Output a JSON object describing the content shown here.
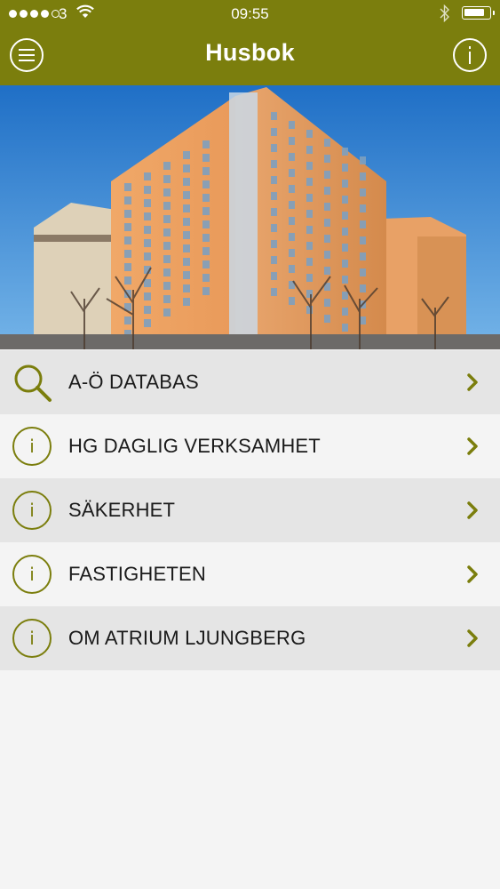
{
  "status_bar": {
    "carrier": "3",
    "time": "09:55",
    "battery_level": 0.85
  },
  "header": {
    "title": "Husbok",
    "menu_icon": "hamburger-menu-icon",
    "info_icon": "info-icon"
  },
  "menu": {
    "items": [
      {
        "label": "A-Ö DATABAS",
        "icon": "search-icon"
      },
      {
        "label": "HG DAGLIG VERKSAMHET",
        "icon": "info-icon"
      },
      {
        "label": "SÄKERHET",
        "icon": "info-icon"
      },
      {
        "label": "FASTIGHETEN",
        "icon": "info-icon"
      },
      {
        "label": "OM ATRIUM LJUNGBERG",
        "icon": "info-icon"
      }
    ]
  },
  "colors": {
    "brand": "#7b7e0d",
    "chevron": "#7b7e0d",
    "row_shade": "#e5e5e5",
    "row_light": "#f4f4f4"
  }
}
